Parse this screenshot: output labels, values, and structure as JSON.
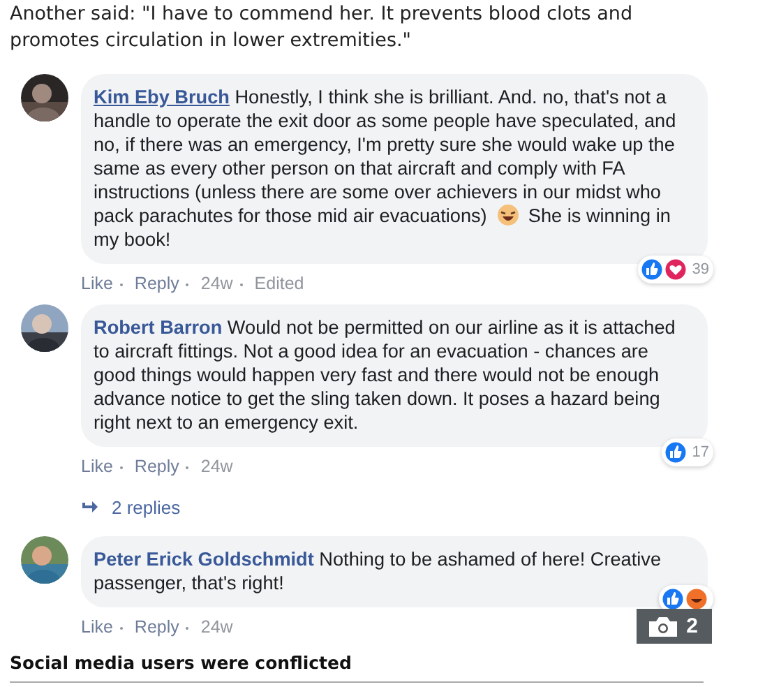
{
  "intro": "Another said: \"I have to commend her. It prevents blood clots and promotes circulation in lower extremities.\"",
  "comments": [
    {
      "name": "Kim Eby Bruch",
      "underlined": true,
      "segments": [
        {
          "kind": "text",
          "text": "Honestly, I think she is brilliant. And. no, that's not a handle to operate the exit door as some people have speculated, and no, if there was an emergency, I'm pretty sure she would wake up the same as every other person on that aircraft and comply with FA instructions (unless there are some over achievers in our midst who pack parachutes for those mid air evacuations)"
        },
        {
          "kind": "emoji"
        },
        {
          "kind": "text",
          "text": "She is winning in my book!"
        }
      ],
      "actions": [
        "Like",
        "Reply",
        "24w",
        "Edited"
      ],
      "reactions": [
        {
          "kind": "like"
        },
        {
          "kind": "love"
        }
      ],
      "count": "39"
    },
    {
      "name": "Robert Barron",
      "underlined": false,
      "segments": [
        {
          "kind": "text",
          "text": "Would not be permitted on our airline as it is attached to aircraft fittings. Not a good idea for an evacuation - chances are good things would happen very fast and there would not be enough advance notice to get the sling taken down. It poses a hazard being right next to an emergency exit."
        }
      ],
      "actions": [
        "Like",
        "Reply",
        "24w"
      ],
      "reactions": [
        {
          "kind": "like"
        }
      ],
      "count": "17",
      "replies": "2 replies"
    },
    {
      "name": "Peter Erick Goldschmidt",
      "underlined": false,
      "segments": [
        {
          "kind": "text",
          "text": "Nothing to be ashamed of here! Creative passenger, that's right!"
        }
      ],
      "actions": [
        "Like",
        "Reply",
        "24w"
      ],
      "reactions": [
        {
          "kind": "like"
        },
        {
          "kind": "haha"
        }
      ]
    }
  ],
  "gallery_badge": {
    "count": "2"
  },
  "caption": "Social media users were conflicted"
}
